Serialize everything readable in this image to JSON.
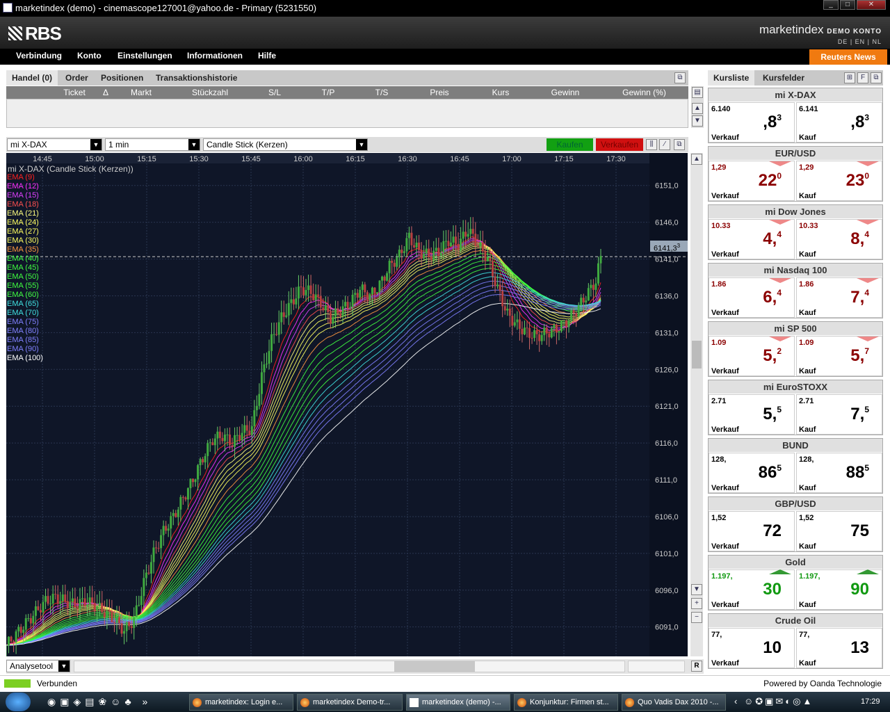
{
  "window": {
    "title": "marketindex (demo) - cinemascope127001@yahoo.de - Primary (5231550)",
    "controls": [
      "_",
      "□",
      "✕"
    ]
  },
  "header": {
    "logo": "RBS",
    "brand": "marketindex",
    "brand_sub": "DEMO KONTO",
    "langs": "DE | EN | NL"
  },
  "menu": {
    "items": [
      "Verbindung",
      "Konto",
      "Einstellungen",
      "Informationen",
      "Hilfe"
    ],
    "reuters": "Reuters News"
  },
  "trade": {
    "tabs": [
      "Handel (0)",
      "Order",
      "Positionen",
      "Transaktionshistorie"
    ],
    "columns": [
      "Ticket",
      "Δ",
      "Markt",
      "Stückzahl",
      "S/L",
      "T/P",
      "T/S",
      "Preis",
      "Kurs",
      "Gewinn",
      "Gewinn (%)"
    ]
  },
  "toolbar": {
    "instrument": "mi X-DAX",
    "interval": "1 min",
    "chart_type": "Candle Stick (Kerzen)",
    "buy": "Kaufen",
    "sell": "Verkaufen"
  },
  "chart": {
    "legend_title": "mi X-DAX (Candle Stick (Kerzen))",
    "current_price": "6141,3",
    "current_price_sup": "3"
  },
  "chart_data": {
    "type": "candlestick",
    "title": "mi X-DAX (Candle Stick (Kerzen))",
    "x_ticks": [
      "14:45",
      "15:00",
      "15:15",
      "15:30",
      "15:45",
      "16:00",
      "16:15",
      "16:30",
      "16:45",
      "17:00",
      "17:15",
      "17:30"
    ],
    "y_ticks": [
      "6151,0",
      "6146,0",
      "6141,0",
      "6136,0",
      "6131,0",
      "6126,0",
      "6121,0",
      "6116,0",
      "6111,0",
      "6106,0",
      "6101,0",
      "6096,0",
      "6091,0"
    ],
    "ylim": [
      6087,
      6154
    ],
    "current": 6141.33,
    "ema_legend": [
      {
        "name": "EMA (9)",
        "color": "#ff2020"
      },
      {
        "name": "EMA (12)",
        "color": "#ff30ff"
      },
      {
        "name": "EMA (15)",
        "color": "#e040ff"
      },
      {
        "name": "EMA (18)",
        "color": "#ff5050"
      },
      {
        "name": "EMA (21)",
        "color": "#ffff80"
      },
      {
        "name": "EMA (24)",
        "color": "#ffff60"
      },
      {
        "name": "EMA (27)",
        "color": "#ffff60"
      },
      {
        "name": "EMA (30)",
        "color": "#ffff60"
      },
      {
        "name": "EMA (35)",
        "color": "#ff9940"
      },
      {
        "name": "EMA (40)",
        "color": "#40ff40"
      },
      {
        "name": "EMA (45)",
        "color": "#40ff40"
      },
      {
        "name": "EMA (50)",
        "color": "#40ff40"
      },
      {
        "name": "EMA (55)",
        "color": "#40ff40"
      },
      {
        "name": "EMA (60)",
        "color": "#40ff40"
      },
      {
        "name": "EMA (65)",
        "color": "#40e0e0"
      },
      {
        "name": "EMA (70)",
        "color": "#40e0e0"
      },
      {
        "name": "EMA (75)",
        "color": "#8080ff"
      },
      {
        "name": "EMA (80)",
        "color": "#8080ff"
      },
      {
        "name": "EMA (85)",
        "color": "#8080ff"
      },
      {
        "name": "EMA (90)",
        "color": "#8080ff"
      },
      {
        "name": "EMA (100)",
        "color": "#ffffff"
      }
    ],
    "price_path": [
      [
        0,
        6088.5
      ],
      [
        4,
        6090
      ],
      [
        8,
        6091.5
      ],
      [
        12,
        6093
      ],
      [
        16,
        6094.5
      ],
      [
        20,
        6095
      ],
      [
        24,
        6094.5
      ],
      [
        28,
        6094
      ],
      [
        32,
        6094.5
      ],
      [
        36,
        6094
      ],
      [
        40,
        6093
      ],
      [
        44,
        6092
      ],
      [
        48,
        6090.5
      ],
      [
        52,
        6092
      ],
      [
        56,
        6097
      ],
      [
        60,
        6101
      ],
      [
        64,
        6104
      ],
      [
        68,
        6106
      ],
      [
        72,
        6108.5
      ],
      [
        76,
        6111
      ],
      [
        80,
        6114
      ],
      [
        84,
        6116.5
      ],
      [
        88,
        6117
      ],
      [
        92,
        6116
      ],
      [
        96,
        6117.5
      ],
      [
        100,
        6118
      ],
      [
        104,
        6125
      ],
      [
        108,
        6130
      ],
      [
        112,
        6133
      ],
      [
        116,
        6135
      ],
      [
        120,
        6137
      ],
      [
        124,
        6136.5
      ],
      [
        128,
        6135
      ],
      [
        132,
        6133
      ],
      [
        136,
        6134
      ],
      [
        140,
        6135
      ],
      [
        144,
        6137
      ],
      [
        148,
        6136
      ],
      [
        152,
        6137.5
      ],
      [
        156,
        6140
      ],
      [
        160,
        6141.5
      ],
      [
        164,
        6144
      ],
      [
        168,
        6142
      ],
      [
        172,
        6141.5
      ],
      [
        176,
        6142
      ],
      [
        180,
        6143.5
      ],
      [
        184,
        6143
      ],
      [
        188,
        6145
      ],
      [
        192,
        6143
      ],
      [
        196,
        6141
      ],
      [
        200,
        6137
      ],
      [
        204,
        6133.5
      ],
      [
        208,
        6132
      ],
      [
        212,
        6131
      ],
      [
        216,
        6130.5
      ],
      [
        220,
        6131
      ],
      [
        224,
        6131.5
      ],
      [
        228,
        6132.5
      ],
      [
        232,
        6134
      ],
      [
        236,
        6136
      ],
      [
        240,
        6138
      ],
      [
        242,
        6141.3
      ]
    ]
  },
  "analysis": {
    "label": "Analysetool",
    "r": "R"
  },
  "right": {
    "tabs": [
      "Kursliste",
      "Kursfelder"
    ],
    "cards": [
      {
        "name": "mi X-DAX",
        "sell_pre": "6.140",
        "sell_big": ",8",
        "sell_sup": "3",
        "buy_pre": "6.141",
        "buy_big": ",8",
        "buy_sup": "3",
        "color": "#000",
        "dir": ""
      },
      {
        "name": "EUR/USD",
        "sell_pre": "1,29",
        "sell_big": "22",
        "sell_sup": "0",
        "buy_pre": "1,29",
        "buy_big": "23",
        "buy_sup": "0",
        "color": "#8b0000",
        "dir": "down"
      },
      {
        "name": "mi Dow Jones",
        "sell_pre": "10.33",
        "sell_big": "4,",
        "sell_sup": "4",
        "buy_pre": "10.33",
        "buy_big": "8,",
        "buy_sup": "4",
        "color": "#8b0000",
        "dir": "down"
      },
      {
        "name": "mi Nasdaq 100",
        "sell_pre": "1.86",
        "sell_big": "6,",
        "sell_sup": "4",
        "buy_pre": "1.86",
        "buy_big": "7,",
        "buy_sup": "4",
        "color": "#8b0000",
        "dir": "down"
      },
      {
        "name": "mi SP 500",
        "sell_pre": "1.09",
        "sell_big": "5,",
        "sell_sup": "2",
        "buy_pre": "1.09",
        "buy_big": "5,",
        "buy_sup": "7",
        "color": "#8b0000",
        "dir": "down"
      },
      {
        "name": "mi EuroSTOXX",
        "sell_pre": "2.71",
        "sell_big": "5,",
        "sell_sup": "5",
        "buy_pre": "2.71",
        "buy_big": "7,",
        "buy_sup": "5",
        "color": "#000",
        "dir": ""
      },
      {
        "name": "BUND",
        "sell_pre": "128,",
        "sell_big": "86",
        "sell_sup": "5",
        "buy_pre": "128,",
        "buy_big": "88",
        "buy_sup": "5",
        "color": "#000",
        "dir": ""
      },
      {
        "name": "GBP/USD",
        "sell_pre": "1,52",
        "sell_big": "72",
        "sell_sup": "",
        "buy_pre": "1,52",
        "buy_big": "75",
        "buy_sup": "",
        "color": "#000",
        "dir": ""
      },
      {
        "name": "Gold",
        "sell_pre": "1.197,",
        "sell_big": "30",
        "sell_sup": "",
        "buy_pre": "1.197,",
        "buy_big": "90",
        "buy_sup": "",
        "color": "#119911",
        "dir": "up"
      },
      {
        "name": "Crude Oil",
        "sell_pre": "77,",
        "sell_big": "10",
        "sell_sup": "",
        "buy_pre": "77,",
        "buy_big": "13",
        "buy_sup": "",
        "color": "#000",
        "dir": ""
      }
    ],
    "sell_label": "Verkauf",
    "buy_label": "Kauf"
  },
  "status": {
    "text": "Verbunden",
    "powered": "Powered by Oanda Technologie"
  },
  "taskbar": {
    "tasks": [
      "marketindex: Login e...",
      "marketindex Demo-tr...",
      "marketindex (demo) -...",
      "Konjunktur: Firmen st...",
      "Quo Vadis Dax 2010 -..."
    ],
    "clock": "17:29"
  }
}
